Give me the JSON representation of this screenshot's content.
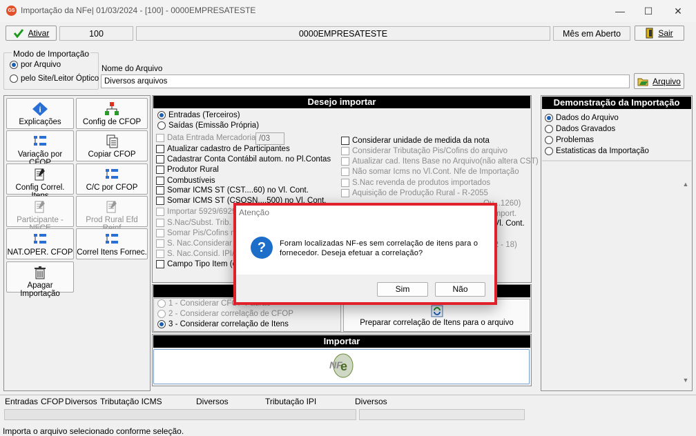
{
  "window": {
    "title": "Importação da NFe|  01/03/2024 - [100] - 0000EMPRESATESTE",
    "app_badge": "GS",
    "min": "—",
    "max": "☐",
    "close": "✕"
  },
  "toolbar": {
    "ativar": "Ativar",
    "code": "100",
    "company": "0000EMPRESATESTE",
    "month_status": "Mês em Aberto",
    "sair": "Sair"
  },
  "mode": {
    "group_label": "Modo de Importação",
    "opt1": "por Arquivo",
    "opt2": "pelo Site/Leitor Óptico",
    "file_label": "Nome do Arquivo",
    "file_value": "Diversos arquivos",
    "arquivo_btn": "Arquivo"
  },
  "left_buttons": [
    "Explicações",
    "Config de CFOP",
    "Variação por CFOP",
    "Copiar CFOP",
    "Config Correl. Itens",
    "C/C por CFOP",
    "Participante - NFCE",
    "Prod Rural Efd Reinf",
    "NAT.OPER. CFOP",
    "Correl Itens Fornec.",
    "Apagar Importação"
  ],
  "desejo": {
    "header": "Desejo importar",
    "r1": "Entradas (Terceiros)",
    "r2": "Saídas (Emissão Própria)",
    "date_label": "Data Entrada Mercadoria",
    "date_value": "/03",
    "left": [
      "Atualizar cadastro de Participantes",
      "Cadastrar Conta Contábil autom. no Pl.Contas",
      "Produtor Rural",
      "Combustíveis",
      "Somar ICMS ST (CST....60) no Vl. Cont.",
      "Somar ICMS ST (CSOSN....500) no Vl. Cont.",
      "Importar 5929/6929",
      "S.Nac/Subst. Trib. E",
      "Somar Pis/Cofins no",
      "S. Nac.Considerar IF",
      "S. Nac.Consid. IPI/F",
      "Campo Tipo Item (ca"
    ],
    "right": [
      "Considerar unidade de medida da nota",
      "Considerar Tributação Pis/Cofins do arquivo",
      "Atualizar cad. Itens Base no Arquivo(não altera CST)",
      "Não somar Icms no Vl.Cont. Nfe de Importação",
      "S.Nac revenda de produtos importados",
      "Aquisição de Produção Rural - R-2055",
      "Ou...1260)",
      "...mport.",
      "...Vl. Cont.",
      "...2 - 18)"
    ]
  },
  "correl": {
    "o1": "1 - Considerar CFOP Padrão",
    "o2": "2 - Considerar correlação de CFOP",
    "o3": "3 - Considerar correlação de Itens",
    "prep": "Preparar correlação de Itens para o arquivo"
  },
  "importar": {
    "header": "Importar",
    "logo": "NF-e"
  },
  "demo": {
    "header": "Demonstração da Importação",
    "items": [
      "Dados do Arquivo",
      "Dados Gravados",
      "Problemas",
      "Estatisticas da Importação"
    ]
  },
  "dialog": {
    "title": "Atenção",
    "message_l1": "Foram localizadas NF-es sem correlação de itens para o",
    "message_l2": "fornecedor. Deseja efetuar a correlação?",
    "yes": "Sim",
    "no": "Não",
    "icon": "?"
  },
  "status": {
    "c1": "Entradas",
    "c2": "CFOP",
    "c3": "Diversos",
    "c4": "Tributação ICMS",
    "c5": "Diversos",
    "c6": "Tributação IPI",
    "c7": "Diversos",
    "message": "Importa o arquivo selecionado conforme seleção."
  }
}
